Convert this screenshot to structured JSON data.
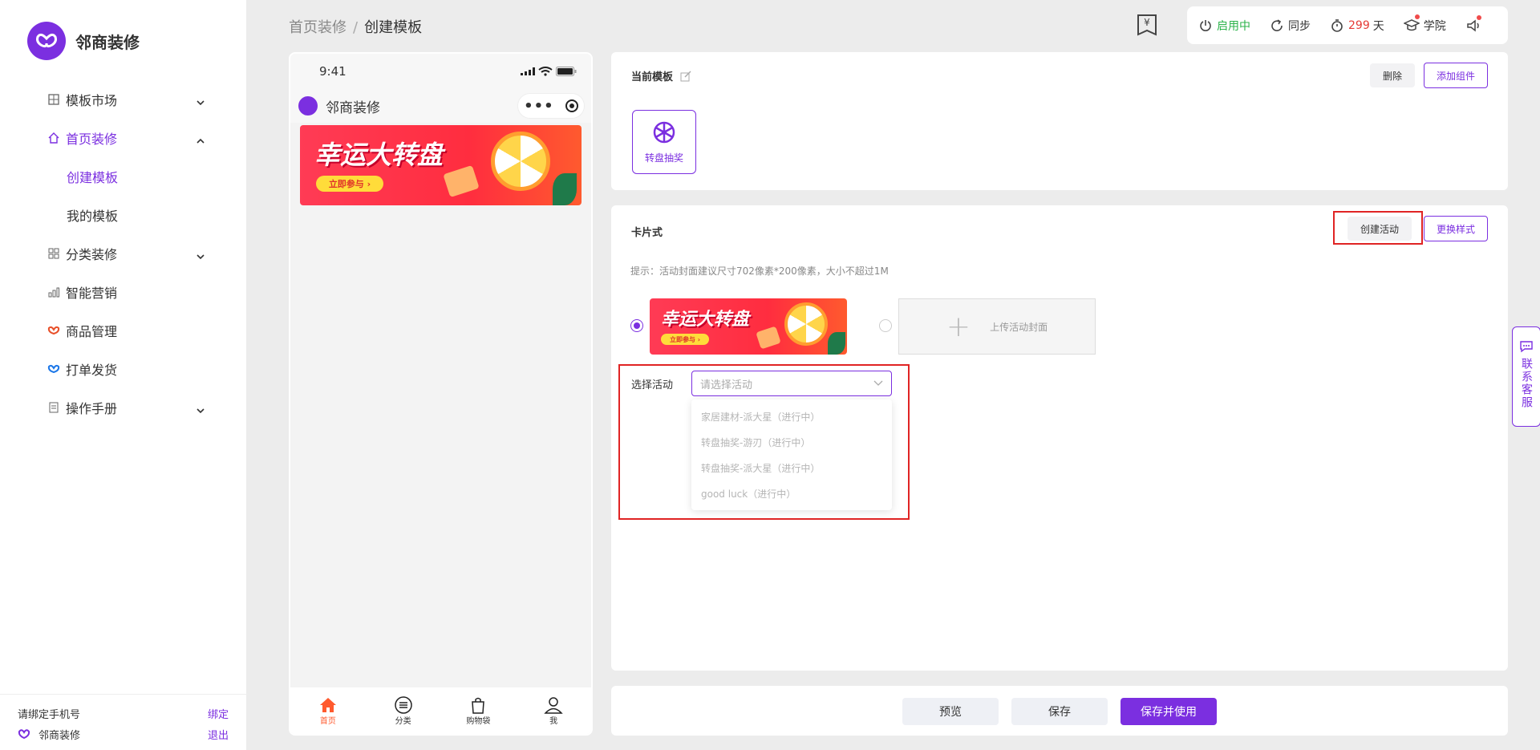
{
  "brand": {
    "name": "邻商装修"
  },
  "sidebar": {
    "items": [
      {
        "label": "模板市场",
        "icon": "grid-icon",
        "expanded": false
      },
      {
        "label": "首页装修",
        "icon": "home-icon",
        "expanded": true,
        "active": true,
        "children": [
          {
            "label": "创建模板",
            "active": true
          },
          {
            "label": "我的模板"
          }
        ]
      },
      {
        "label": "分类装修",
        "icon": "category-icon",
        "expanded": false
      },
      {
        "label": "智能营销",
        "icon": "bar-chart-icon"
      },
      {
        "label": "商品管理",
        "icon": "product-icon"
      },
      {
        "label": "打单发货",
        "icon": "shipping-icon"
      },
      {
        "label": "操作手册",
        "icon": "manual-icon",
        "expanded": false
      }
    ],
    "footer": {
      "phone_prompt": "请绑定手机号",
      "bind": "绑定",
      "shop_name": "邻商装修",
      "logout": "退出"
    }
  },
  "breadcrumb": {
    "parent": "首页装修",
    "sep": "/",
    "current": "创建模板"
  },
  "header_tools": {
    "status": "启用中",
    "sync": "同步",
    "days_num": "299",
    "days_unit": "天",
    "academy": "学院"
  },
  "phone": {
    "time": "9:41",
    "title": "邻商装修",
    "banner": {
      "title": "幸运大转盘",
      "button": "立即参与"
    },
    "tabs": [
      {
        "label": "首页",
        "icon": "home-icon",
        "active": true
      },
      {
        "label": "分类",
        "icon": "list-icon"
      },
      {
        "label": "购物袋",
        "icon": "bag-icon"
      },
      {
        "label": "我",
        "icon": "user-icon"
      }
    ]
  },
  "current_template": {
    "title": "当前模板",
    "delete": "删除",
    "add_component": "添加组件",
    "component": {
      "label": "转盘抽奖",
      "icon": "wheel-icon"
    }
  },
  "card_panel": {
    "title": "卡片式",
    "create_activity": "创建活动",
    "change_style": "更换样式",
    "hint": "提示：活动封面建议尺寸702像素*200像素，大小不超过1M",
    "upload_label": "上传活动封面",
    "select_label": "选择活动",
    "select_placeholder": "请选择活动",
    "options": [
      "家居建材-派大星（进行中）",
      "转盘抽奖-游刃（进行中）",
      "转盘抽奖-派大星（进行中）",
      "good luck（进行中）"
    ]
  },
  "customer_service": {
    "label": "联系客服"
  },
  "actions": {
    "preview": "预览",
    "save": "保存",
    "save_use": "保存并使用"
  },
  "colors": {
    "accent": "#7b2fe0",
    "highlight_box": "#e02424",
    "status_green": "#2cb34a"
  }
}
